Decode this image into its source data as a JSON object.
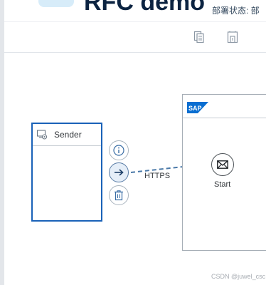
{
  "header": {
    "title": "RFC demo",
    "deploy_status_label": "部署状态: 部"
  },
  "toolbar": {
    "buttons": [
      {
        "icon": "copy-icon"
      },
      {
        "icon": "save-as-icon"
      }
    ]
  },
  "canvas": {
    "sender": {
      "label": "Sender",
      "icon": "sender-system-icon"
    },
    "connector_actions": [
      {
        "icon": "info-icon"
      },
      {
        "icon": "arrow-right-icon"
      },
      {
        "icon": "trash-icon"
      }
    ],
    "connection": {
      "label": "HTTPS"
    },
    "integration_process": {
      "logo_text": "SAP",
      "start_event": {
        "label": "Start",
        "icon": "envelope-icon"
      }
    }
  },
  "watermark": "CSDN @juwel_csc",
  "colors": {
    "accent": "#1a62b8",
    "title": "#0b2341",
    "connection": "#4a79a8",
    "sap_blue": "#0a6ed1"
  }
}
